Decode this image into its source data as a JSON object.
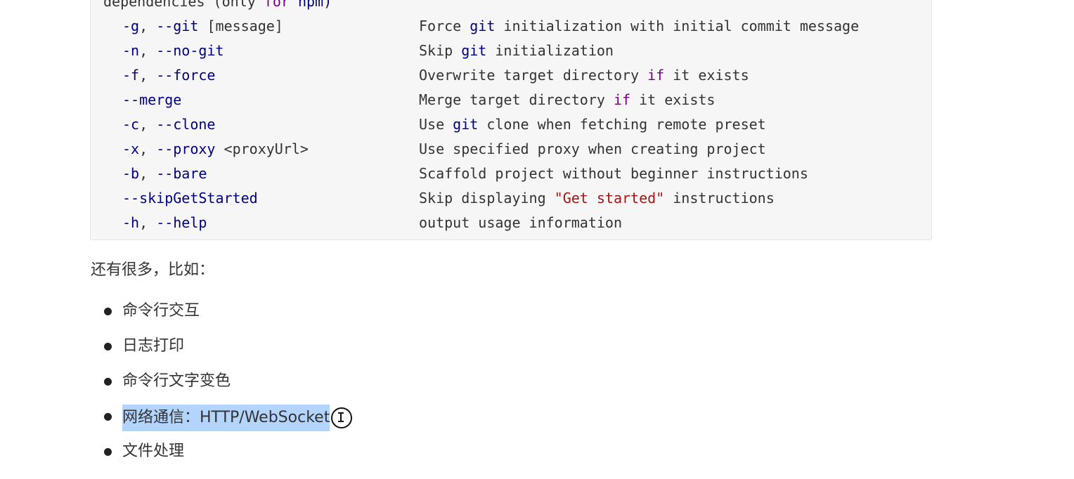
{
  "code_block": {
    "continued_line": {
      "parts": [
        {
          "text": "dependencies (only ",
          "style": "arg"
        },
        {
          "text": "for",
          "style": "hl"
        },
        {
          "text": " npm)",
          "style": "kw"
        }
      ]
    },
    "options": [
      {
        "flags": [
          {
            "text": "-g",
            "style": "kw"
          },
          {
            "text": ", ",
            "style": "arg"
          },
          {
            "text": "--git",
            "style": "kw"
          },
          {
            "text": " [message]",
            "style": "arg"
          }
        ],
        "description": [
          {
            "text": "Force ",
            "style": "arg"
          },
          {
            "text": "git",
            "style": "git"
          },
          {
            "text": " initialization with initial commit message",
            "style": "arg"
          }
        ]
      },
      {
        "flags": [
          {
            "text": "-n",
            "style": "kw"
          },
          {
            "text": ", ",
            "style": "arg"
          },
          {
            "text": "--no-git",
            "style": "kw"
          }
        ],
        "description": [
          {
            "text": "Skip ",
            "style": "arg"
          },
          {
            "text": "git",
            "style": "git"
          },
          {
            "text": " initialization",
            "style": "arg"
          }
        ]
      },
      {
        "flags": [
          {
            "text": "-f",
            "style": "kw"
          },
          {
            "text": ", ",
            "style": "arg"
          },
          {
            "text": "--force",
            "style": "kw"
          }
        ],
        "description": [
          {
            "text": "Overwrite target directory ",
            "style": "arg"
          },
          {
            "text": "if",
            "style": "hl"
          },
          {
            "text": " it exists",
            "style": "arg"
          }
        ]
      },
      {
        "flags": [
          {
            "text": "--merge",
            "style": "kw"
          }
        ],
        "description": [
          {
            "text": "Merge target directory ",
            "style": "arg"
          },
          {
            "text": "if",
            "style": "hl"
          },
          {
            "text": " it exists",
            "style": "arg"
          }
        ]
      },
      {
        "flags": [
          {
            "text": "-c",
            "style": "kw"
          },
          {
            "text": ", ",
            "style": "arg"
          },
          {
            "text": "--clone",
            "style": "kw"
          }
        ],
        "description": [
          {
            "text": "Use ",
            "style": "arg"
          },
          {
            "text": "git",
            "style": "git"
          },
          {
            "text": " clone when fetching remote preset",
            "style": "arg"
          }
        ]
      },
      {
        "flags": [
          {
            "text": "-x",
            "style": "kw"
          },
          {
            "text": ", ",
            "style": "arg"
          },
          {
            "text": "--proxy",
            "style": "kw"
          },
          {
            "text": " <proxyUrl>",
            "style": "arg"
          }
        ],
        "description": [
          {
            "text": "Use specified proxy when creating project",
            "style": "arg"
          }
        ]
      },
      {
        "flags": [
          {
            "text": "-b",
            "style": "kw"
          },
          {
            "text": ", ",
            "style": "arg"
          },
          {
            "text": "--bare",
            "style": "kw"
          }
        ],
        "description": [
          {
            "text": "Scaffold project without beginner instructions",
            "style": "arg"
          }
        ]
      },
      {
        "flags": [
          {
            "text": "--skipGetStarted",
            "style": "kw"
          }
        ],
        "description": [
          {
            "text": "Skip displaying ",
            "style": "arg"
          },
          {
            "text": "\"Get started\"",
            "style": "str"
          },
          {
            "text": " instructions",
            "style": "arg"
          }
        ]
      },
      {
        "flags": [
          {
            "text": "-h",
            "style": "kw"
          },
          {
            "text": ", ",
            "style": "arg"
          },
          {
            "text": "--help",
            "style": "kw"
          }
        ],
        "description": [
          {
            "text": "output usage information",
            "style": "arg"
          }
        ]
      }
    ]
  },
  "paragraph": "还有很多，比如：",
  "list": [
    {
      "text": "命令行交互",
      "selected": false
    },
    {
      "text": "日志打印",
      "selected": false
    },
    {
      "text": "命令行文字变色",
      "selected": false
    },
    {
      "text": "网络通信：HTTP/WebSocket",
      "selected": true
    },
    {
      "text": "文件处理",
      "selected": false
    }
  ],
  "colors": {
    "code_background": "#f6f6f6",
    "keyword": "#000080",
    "highlight_keyword": "#770088",
    "string": "#a31515",
    "selection": "#b3d4fc"
  },
  "cursor": {
    "icon": "text-cursor-icon"
  }
}
